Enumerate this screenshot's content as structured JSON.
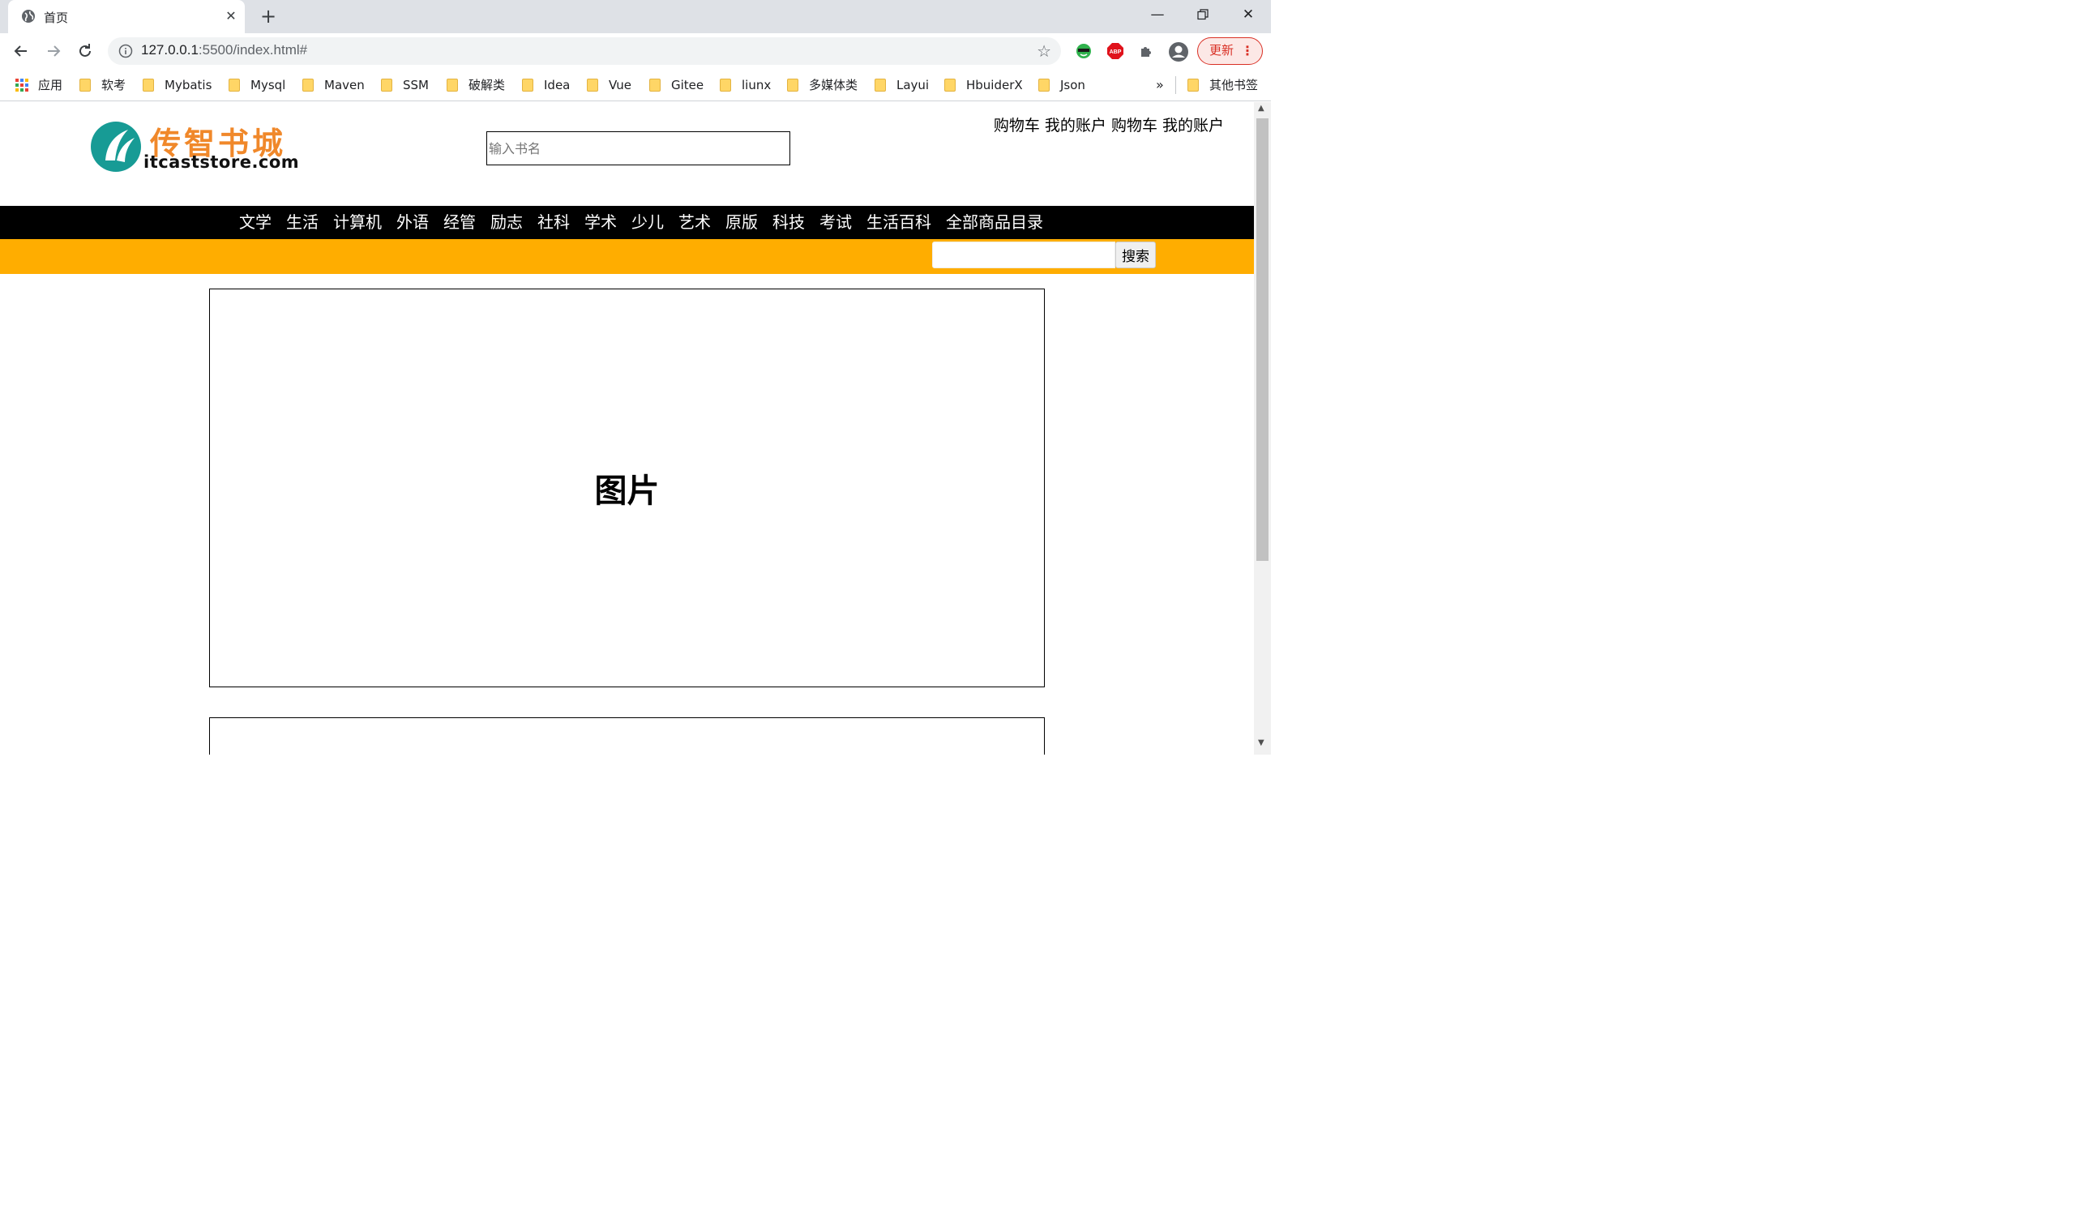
{
  "browser": {
    "tab_title": "首页",
    "url_host": "127.0.0.1",
    "url_rest": ":5500/index.html#",
    "update_label": "更新",
    "extensions": [
      "green-extension-icon",
      "adblock-icon",
      "puzzle-extensions-icon",
      "profile-icon"
    ],
    "bookmarks": [
      {
        "label": "应用",
        "type": "apps"
      },
      {
        "label": "软考",
        "type": "folder"
      },
      {
        "label": "Mybatis",
        "type": "folder"
      },
      {
        "label": "Mysql",
        "type": "folder"
      },
      {
        "label": "Maven",
        "type": "folder"
      },
      {
        "label": "SSM",
        "type": "folder"
      },
      {
        "label": "破解类",
        "type": "folder"
      },
      {
        "label": "Idea",
        "type": "folder"
      },
      {
        "label": "Vue",
        "type": "folder"
      },
      {
        "label": "Gitee",
        "type": "folder"
      },
      {
        "label": "liunx",
        "type": "folder"
      },
      {
        "label": "多媒体类",
        "type": "folder"
      },
      {
        "label": "Layui",
        "type": "folder"
      },
      {
        "label": "HbuiderX",
        "type": "folder"
      },
      {
        "label": "Json",
        "type": "folder"
      }
    ],
    "bookmarks_overflow": "»",
    "other_bookmarks": "其他书签"
  },
  "page": {
    "logo_cn": "传智书城",
    "logo_en": "itcaststore.com",
    "top_search_placeholder": "输入书名",
    "account_links": "购物车 我的账户 购物车 我的账户",
    "categories": [
      "文学",
      "生活",
      "计算机",
      "外语",
      "经管",
      "励志",
      "社科",
      "学术",
      "少儿",
      "艺术",
      "原版",
      "科技",
      "考试",
      "生活百科",
      "全部商品目录"
    ],
    "search_button": "搜索",
    "banner_text": "图片",
    "colors": {
      "nav_bg": "#000000",
      "search_bar_bg": "#ffad00",
      "logo_orange": "#f0882a",
      "logo_teal": "#179b95"
    }
  }
}
